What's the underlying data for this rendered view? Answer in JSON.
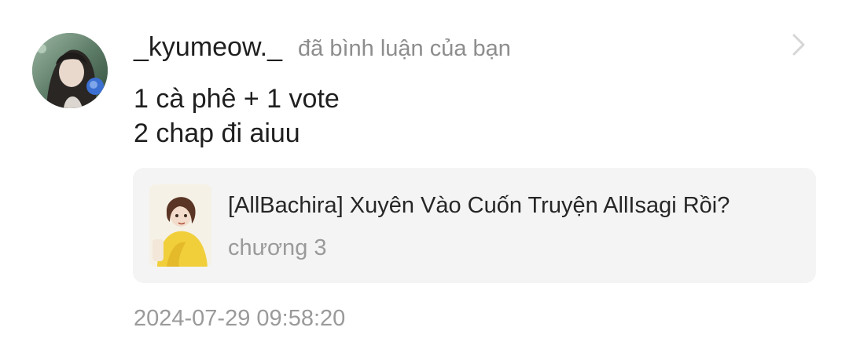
{
  "notification": {
    "username": "_kyumeow._",
    "action_text": "đã bình luận của bạn",
    "comment_lines": [
      "1 cà phê + 1 vote",
      "2 chap đi aiuu"
    ],
    "story": {
      "title": "[AllBachira] Xuyên Vào Cuốn Truyện AllIsagi Rồi?",
      "chapter": "chương 3"
    },
    "timestamp": "2024-07-29 09:58:20"
  },
  "icons": {
    "chevron": "chevron-right-icon",
    "avatar": "user-avatar-image",
    "cover": "story-cover-image"
  },
  "colors": {
    "primary_text": "#1f1f1f",
    "secondary_text": "#8d8d8d",
    "card_background": "#f4f4f4",
    "chevron": "#d6d6d6"
  }
}
